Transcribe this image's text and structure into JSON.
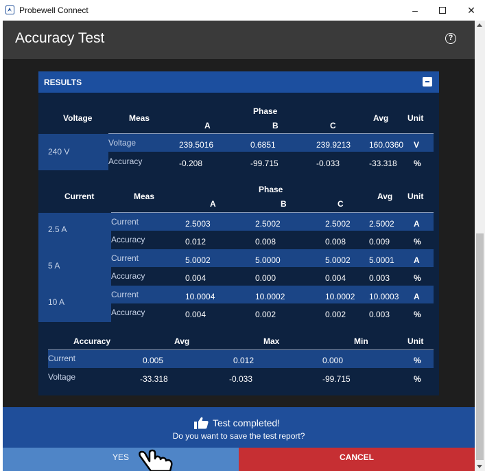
{
  "window": {
    "title": "Probewell Connect",
    "min": "–",
    "close": "✕"
  },
  "header": {
    "title": "Accuracy Test",
    "help": "?"
  },
  "panel": {
    "title": "RESULTS"
  },
  "voltage_table": {
    "h_voltage": "Voltage",
    "h_meas": "Meas",
    "h_phase": "Phase",
    "h_a": "A",
    "h_b": "B",
    "h_c": "C",
    "h_avg": "Avg",
    "h_unit": "Unit",
    "group": "240 V",
    "rows": [
      {
        "meas": "Voltage",
        "a": "239.5016",
        "b": "0.6851",
        "c": "239.9213",
        "avg": "160.0360",
        "unit": "V"
      },
      {
        "meas": "Accuracy",
        "a": "-0.208",
        "b": "-99.715",
        "c": "-0.033",
        "avg": "-33.318",
        "unit": "%"
      }
    ]
  },
  "current_table": {
    "h_current": "Current",
    "h_meas": "Meas",
    "h_phase": "Phase",
    "h_a": "A",
    "h_b": "B",
    "h_c": "C",
    "h_avg": "Avg",
    "h_unit": "Unit",
    "groups": [
      {
        "label": "2.5 A",
        "rows": [
          {
            "meas": "Current",
            "a": "2.5003",
            "b": "2.5002",
            "c": "2.5002",
            "avg": "2.5002",
            "unit": "A"
          },
          {
            "meas": "Accuracy",
            "a": "0.012",
            "b": "0.008",
            "c": "0.008",
            "avg": "0.009",
            "unit": "%"
          }
        ]
      },
      {
        "label": "5 A",
        "rows": [
          {
            "meas": "Current",
            "a": "5.0002",
            "b": "5.0000",
            "c": "5.0002",
            "avg": "5.0001",
            "unit": "A"
          },
          {
            "meas": "Accuracy",
            "a": "0.004",
            "b": "0.000",
            "c": "0.004",
            "avg": "0.003",
            "unit": "%"
          }
        ]
      },
      {
        "label": "10 A",
        "rows": [
          {
            "meas": "Current",
            "a": "10.0004",
            "b": "10.0002",
            "c": "10.0002",
            "avg": "10.0003",
            "unit": "A"
          },
          {
            "meas": "Accuracy",
            "a": "0.004",
            "b": "0.002",
            "c": "0.002",
            "avg": "0.003",
            "unit": "%"
          }
        ]
      }
    ]
  },
  "summary_table": {
    "h_accuracy": "Accuracy",
    "h_avg": "Avg",
    "h_max": "Max",
    "h_min": "Min",
    "h_unit": "Unit",
    "rows": [
      {
        "label": "Current",
        "avg": "0.005",
        "max": "0.012",
        "min": "0.000",
        "unit": "%"
      },
      {
        "label": "Voltage",
        "avg": "-33.318",
        "max": "-0.033",
        "min": "-99.715",
        "unit": "%"
      }
    ]
  },
  "banner": {
    "title": "Test completed!",
    "subtitle": "Do you want to save the test report?"
  },
  "buttons": {
    "yes": "YES",
    "cancel": "CANCEL"
  },
  "colors": {
    "panel": "#0d2240",
    "panel_header": "#1c4f9f",
    "row_band": "#1b4586",
    "banner": "#1f4e9a",
    "yes": "#4f85c7",
    "cancel": "#c62f33"
  }
}
